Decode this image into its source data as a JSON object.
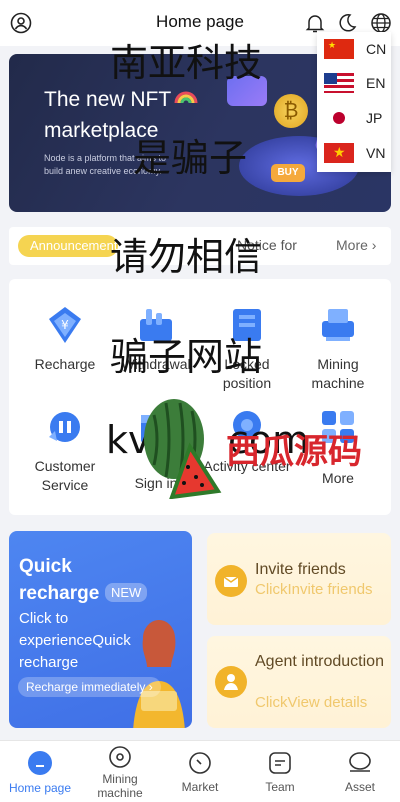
{
  "header": {
    "title": "Home page"
  },
  "banner": {
    "title_line1": "The new NFT",
    "title_line2": "marketplace",
    "subtitle": "Node is a platform that aims to build anew creative economy.",
    "coin_label": "BUY"
  },
  "languages": [
    {
      "code": "CN"
    },
    {
      "code": "EN"
    },
    {
      "code": "JP"
    },
    {
      "code": "VN"
    }
  ],
  "announcement": {
    "badge": "Announcement",
    "text": "Notice for",
    "more": "More"
  },
  "grid": [
    {
      "label": "Recharge"
    },
    {
      "label": "Withdrawal"
    },
    {
      "label": "Locked position"
    },
    {
      "label": "Mining machine"
    },
    {
      "label": "Customer Service"
    },
    {
      "label": "Sign in"
    },
    {
      "label": "Activity center"
    },
    {
      "label": "More"
    }
  ],
  "promo_quick": {
    "title": "Quick recharge",
    "badge": "NEW",
    "desc": "Click to experienceQuick recharge",
    "button": "Recharge immediately"
  },
  "promo_invite": {
    "title": "Invite friends",
    "sub": "ClickInvite friends"
  },
  "promo_agent": {
    "title": "Agent introduction",
    "sub": "ClickView details"
  },
  "nav": [
    {
      "label": "Home page"
    },
    {
      "label": "Mining machine"
    },
    {
      "label": "Market"
    },
    {
      "label": "Team"
    },
    {
      "label": "Asset"
    }
  ],
  "overlay": {
    "line1": "南亚科技",
    "line2": "是骗子",
    "line3": "请勿相信",
    "line4": "骗子网站",
    "line5a": "kv",
    "line5b": "com",
    "watermark": "西瓜源码"
  },
  "colors": {
    "accent": "#3a7bf0",
    "badge_yellow": "#f5d451"
  }
}
